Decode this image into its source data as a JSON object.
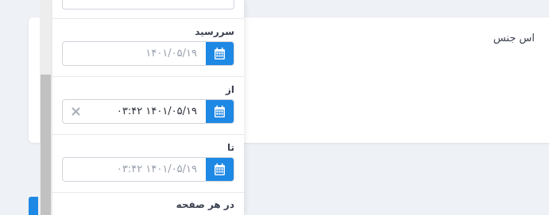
{
  "background_card": {
    "title": "اس جنس"
  },
  "filters": {
    "due_date": {
      "label": "سررسید",
      "placeholder": "۱۴۰۱/۰۵/۱۹"
    },
    "from": {
      "label": "از",
      "value": "۱۴۰۱/۰۵/۱۹ ۰۳:۴۲"
    },
    "to": {
      "label": "تا",
      "placeholder": "۱۴۰۱/۰۵/۱۹ ۰۳:۴۲"
    },
    "per_page": {
      "label": "در هر صفحه"
    }
  },
  "icons": {
    "calendar": "calendar-icon",
    "clear": "close-icon"
  },
  "colors": {
    "accent": "#1e88e5",
    "background": "#eef1f6"
  }
}
